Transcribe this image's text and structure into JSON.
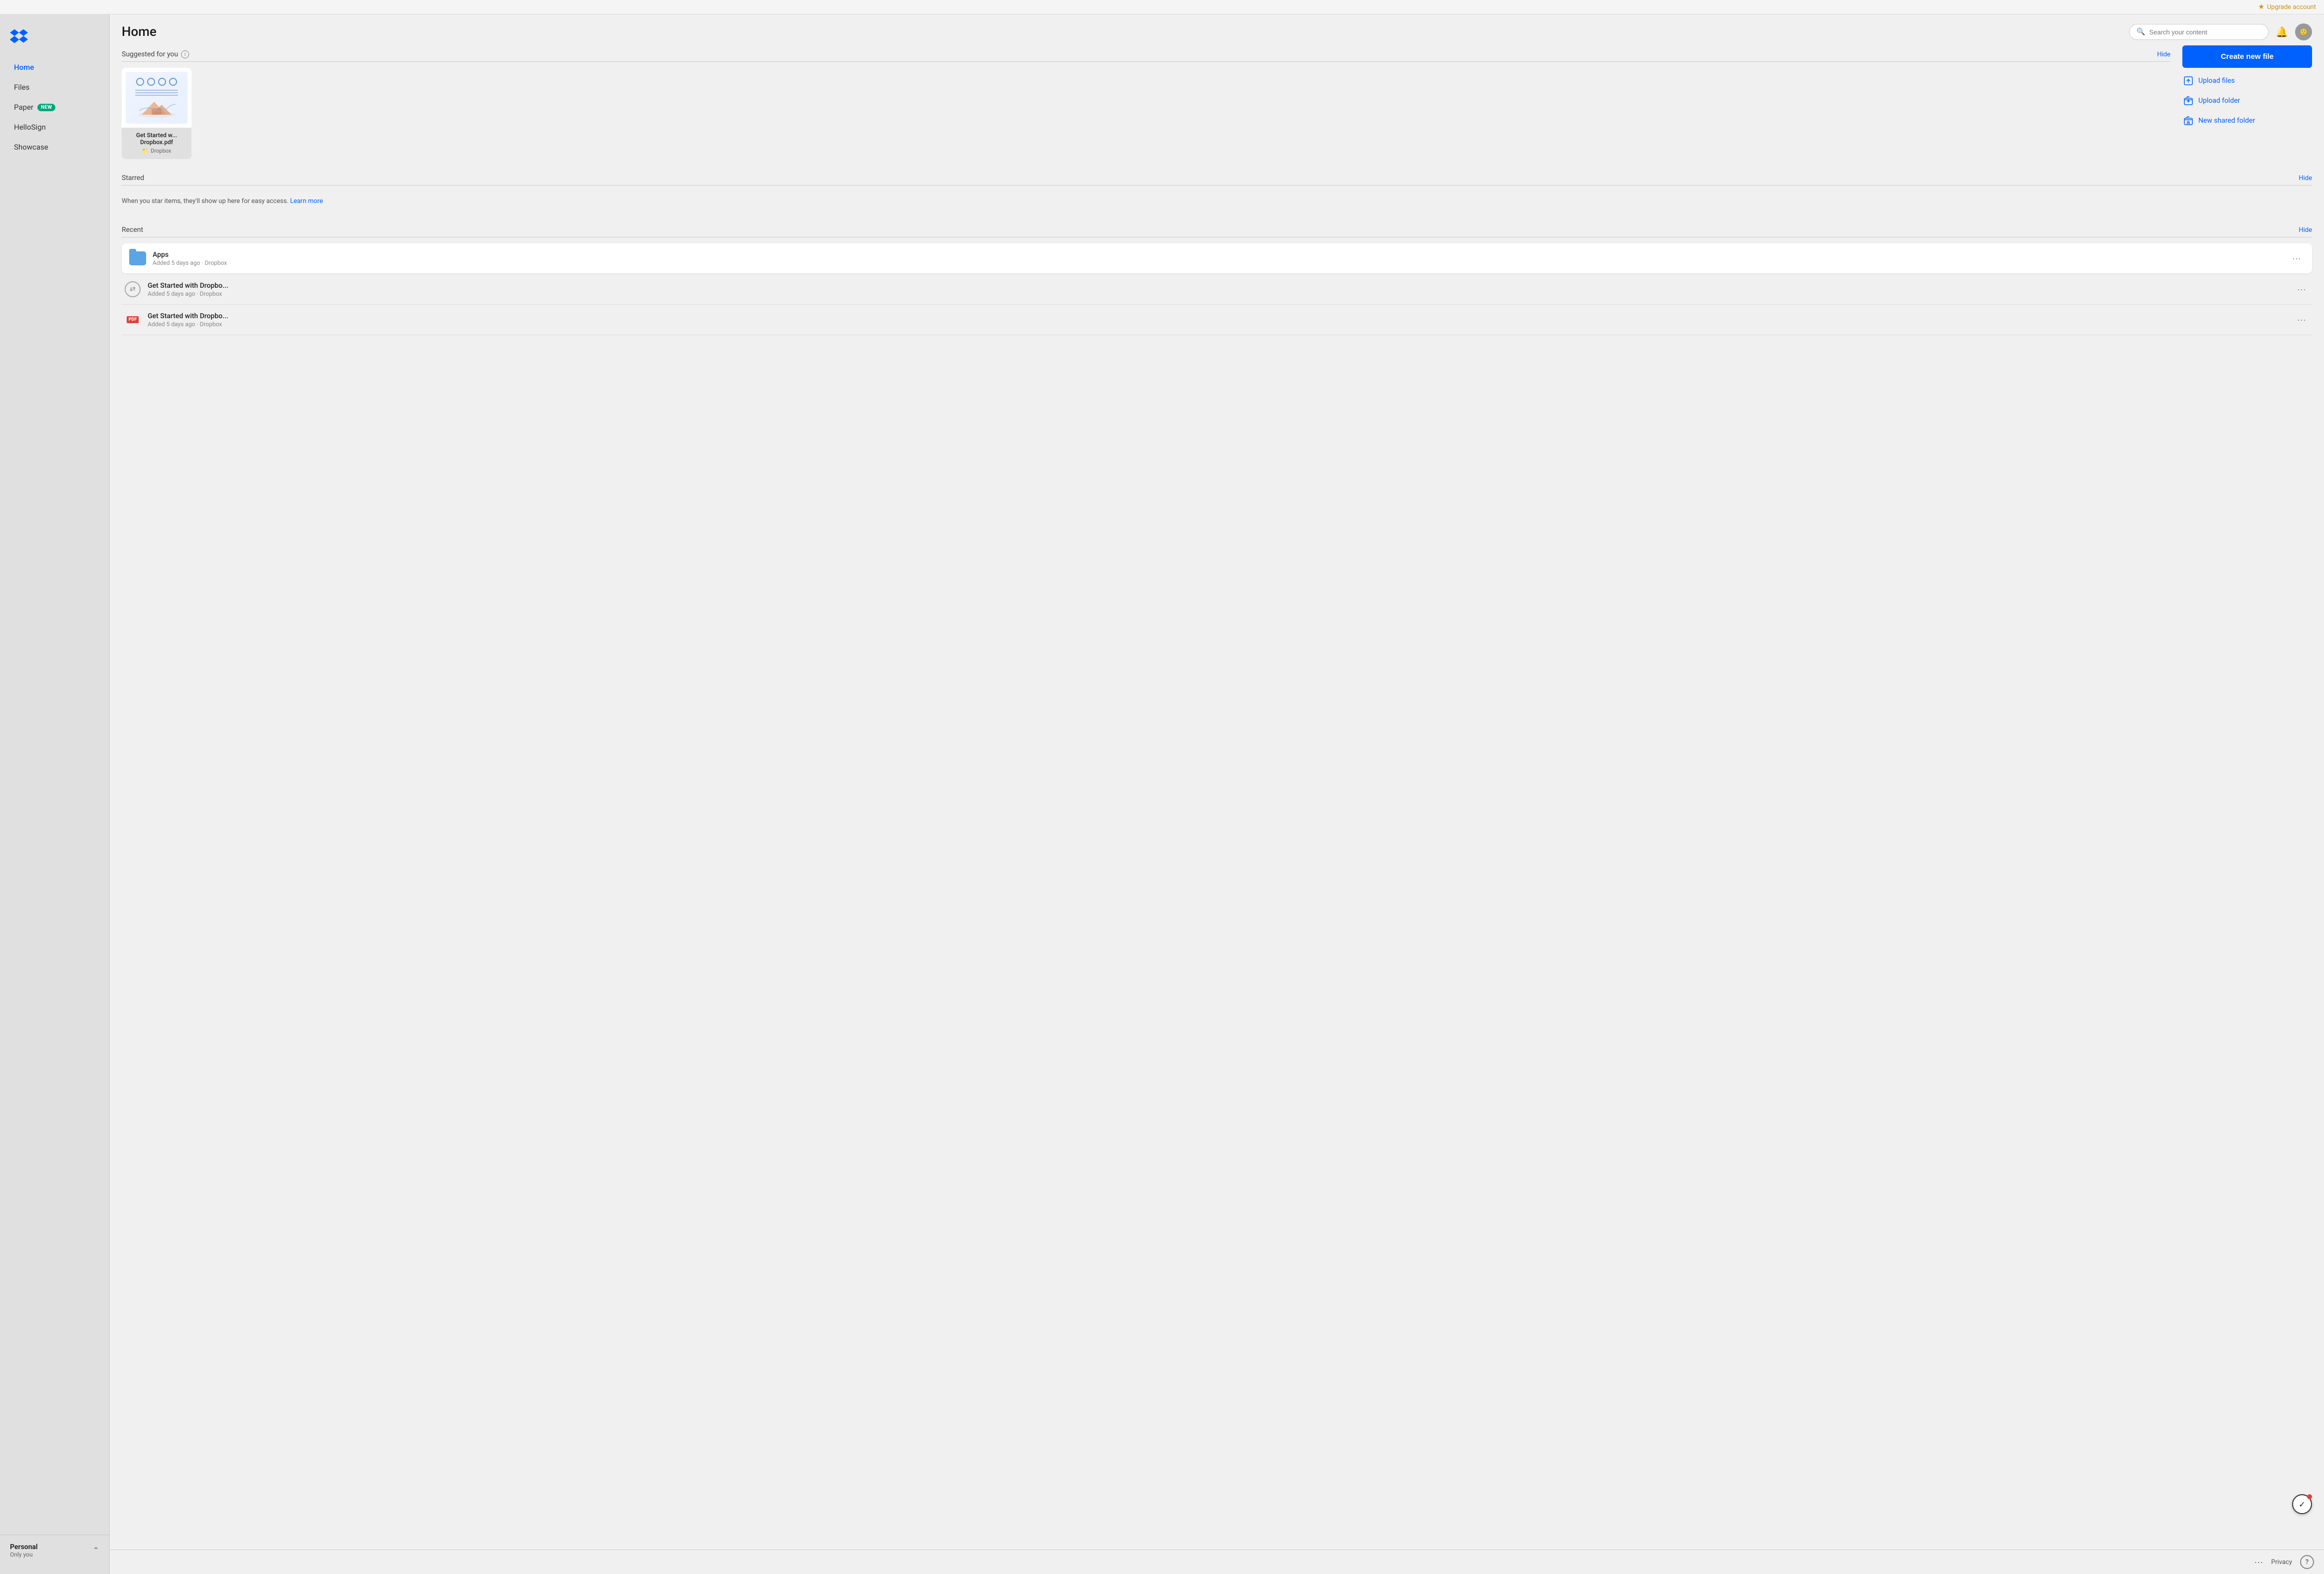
{
  "topbar": {
    "upgrade_label": "Upgrade account"
  },
  "sidebar": {
    "nav_items": [
      {
        "id": "home",
        "label": "Home",
        "active": true
      },
      {
        "id": "files",
        "label": "Files",
        "active": false
      },
      {
        "id": "paper",
        "label": "Paper",
        "active": false,
        "badge": "New"
      },
      {
        "id": "hellosign",
        "label": "HelloSign",
        "active": false
      },
      {
        "id": "showcase",
        "label": "Showcase",
        "active": false
      }
    ],
    "bottom": {
      "title": "Personal",
      "subtitle": "Only you"
    }
  },
  "header": {
    "page_title": "Home",
    "search_placeholder": "Search your content",
    "avatar_initials": ""
  },
  "suggested": {
    "section_title": "Suggested for you",
    "hide_label": "Hide",
    "file": {
      "name": "Get Started w... Dropbox.pdf",
      "location": "Dropbox"
    }
  },
  "actions": {
    "create_label": "Create new file",
    "upload_files_label": "Upload files",
    "upload_folder_label": "Upload folder",
    "new_shared_folder_label": "New shared folder"
  },
  "starred": {
    "section_title": "Starred",
    "hide_label": "Hide",
    "empty_text": "When you star items, they'll show up here for easy access.",
    "learn_more_label": "Learn more"
  },
  "recent": {
    "section_title": "Recent",
    "hide_label": "Hide",
    "items": [
      {
        "id": "apps",
        "name": "Apps",
        "sub": "Added 5 days ago · Dropbox",
        "type": "folder"
      },
      {
        "id": "get-started-link",
        "name": "Get Started with Dropbo...",
        "sub": "Added 5 days ago · Dropbox",
        "type": "link"
      },
      {
        "id": "get-started-pdf",
        "name": "Get Started with Dropbo...",
        "sub": "Added 5 days ago · Dropbox",
        "type": "pdf"
      }
    ]
  },
  "footer": {
    "more_label": "···",
    "privacy_label": "Privacy",
    "help_label": "?"
  },
  "floating": {
    "check_label": "✓"
  }
}
